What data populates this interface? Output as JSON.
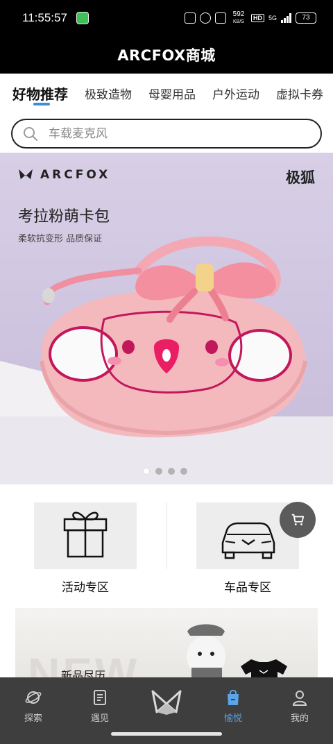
{
  "status_bar": {
    "time": "11:55:57",
    "net_speed_value": "592",
    "net_speed_unit": "KB/S",
    "hd_badge": "HD",
    "network_type": "5G",
    "battery": "73"
  },
  "header": {
    "title": "ARCFOX商城"
  },
  "tabs": [
    {
      "label": "好物推荐",
      "active": true
    },
    {
      "label": "极致造物"
    },
    {
      "label": "母婴用品"
    },
    {
      "label": "户外运动"
    },
    {
      "label": "虚拟卡券"
    }
  ],
  "search": {
    "placeholder": "车载麦克风"
  },
  "banner": {
    "brand": "ARCFOX",
    "brand_cn": "极狐",
    "title": "考拉粉萌卡包",
    "subtitle": "柔软抗变形 品质保证",
    "slide_count": 4,
    "active_slide": 1
  },
  "quick_entries": [
    {
      "label": "活动专区",
      "icon": "gift-icon"
    },
    {
      "label": "车品专区",
      "icon": "car-icon"
    }
  ],
  "floating_cart": {
    "icon": "cart-icon"
  },
  "new_section": {
    "background_word": "NEW",
    "title": "新品尽历"
  },
  "bottom_nav": [
    {
      "label": "探索",
      "icon": "planet-icon"
    },
    {
      "label": "遇见",
      "icon": "document-icon"
    },
    {
      "label": "",
      "icon": "arcfox-logo-icon"
    },
    {
      "label": "愉悦",
      "icon": "shopping-bag-icon",
      "active": true
    },
    {
      "label": "我的",
      "icon": "profile-icon"
    }
  ],
  "colors": {
    "accent": "#3b8fd9",
    "nav_active": "#5aa5ea",
    "header_bg": "#000000",
    "nav_bg": "#3e3e3e"
  }
}
